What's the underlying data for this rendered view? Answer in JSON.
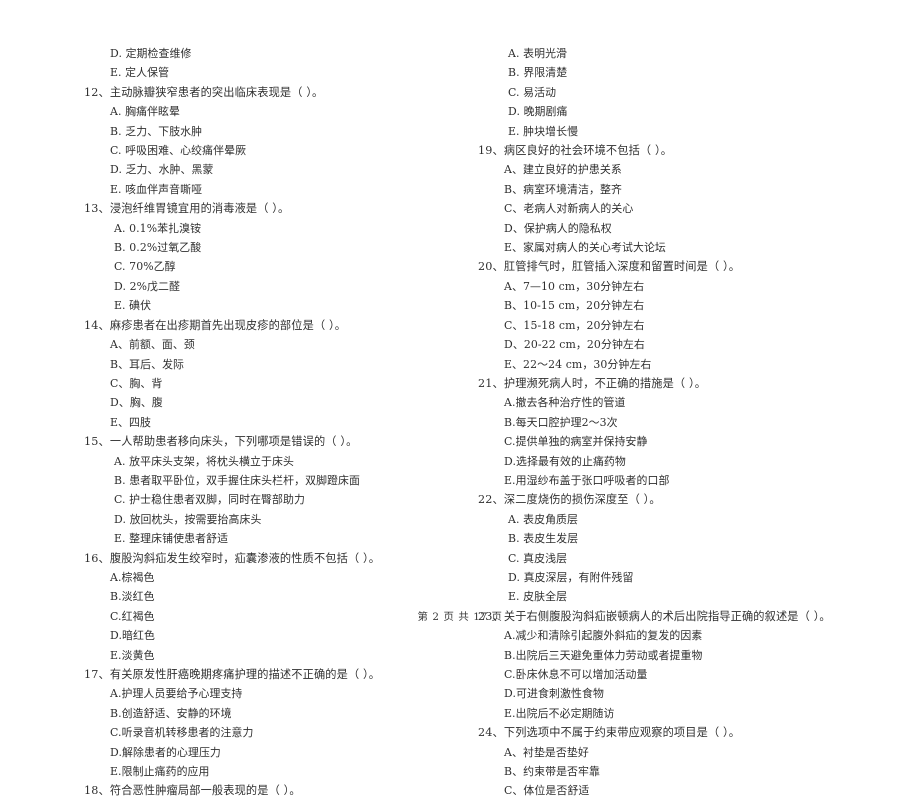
{
  "document": {
    "type": "exam-paper",
    "footer": "第 2 页 共 17 页",
    "page_number": "2",
    "total_pages": "17",
    "text_color": "#2f2f2f",
    "background_color": "#ffffff"
  },
  "left_column": {
    "orphan_options": [
      "D. 定期检查维修",
      "E. 定人保管"
    ],
    "questions": [
      {
        "number": "12",
        "stem": "12、主动脉瓣狭窄患者的突出临床表现是（      ）。",
        "options": [
          "A. 胸痛伴眩晕",
          "B. 乏力、下肢水肿",
          "C. 呼吸困难、心绞痛伴晕厥",
          "D. 乏力、水肿、黑蒙",
          "E. 咳血伴声音嘶哑"
        ]
      },
      {
        "number": "13",
        "stem": "13、浸泡纤维胃镜宜用的消毒液是（      ）。",
        "options": [
          "A. 0.1%苯扎溴铵",
          "B. 0.2%过氧乙酸",
          "C. 70%乙醇",
          "D. 2%戊二醛",
          "E. 碘伏"
        ]
      },
      {
        "number": "14",
        "stem": "14、麻疹患者在出疹期首先出现皮疹的部位是（      ）。",
        "options": [
          "A、前额、面、颈",
          "B、耳后、发际",
          "C、胸、背",
          "D、胸、腹",
          "E、四肢"
        ]
      },
      {
        "number": "15",
        "stem": "15、一人帮助患者移向床头，下列哪项是错误的（      ）。",
        "options": [
          "A.  放平床头支架，将枕头横立于床头",
          "B.  患者取平卧位，双手握住床头栏杆，双脚蹬床面",
          "C.  护士稳住患者双脚，同时在臀部助力",
          "D.  放回枕头，按需要抬高床头",
          "E.  整理床铺使患者舒适"
        ]
      },
      {
        "number": "16",
        "stem": "16、腹股沟斜疝发生绞窄时，疝囊渗液的性质不包括（      ）。",
        "options": [
          "A.棕褐色",
          "B.淡红色",
          "C.红褐色",
          "D.暗红色",
          "E.淡黄色"
        ]
      },
      {
        "number": "17",
        "stem": "17、有关原发性肝癌晚期疼痛护理的描述不正确的是（      ）。",
        "options": [
          "A.护理人员要给予心理支持",
          "B.创造舒适、安静的环境",
          "C.听录音机转移患者的注意力",
          "D.解除患者的心理压力",
          "E.限制止痛药的应用"
        ]
      },
      {
        "number": "18",
        "stem": "18、符合恶性肿瘤局部一般表现的是（      ）。",
        "options": []
      }
    ]
  },
  "right_column": {
    "orphan_options": [
      "A.  表明光滑",
      "B.  界限清楚",
      "C.  易活动",
      "D.  晚期剧痛",
      "E.  肿块增长慢"
    ],
    "questions": [
      {
        "number": "19",
        "stem": "19、病区良好的社会环境不包括（      ）。",
        "options": [
          "A、建立良好的护患关系",
          "B、病室环境清洁，整齐",
          "C、老病人对新病人的关心",
          "D、保护病人的隐私权",
          "E、家属对病人的关心考试大论坛"
        ]
      },
      {
        "number": "20",
        "stem": "20、肛管排气时，肛管插入深度和留置时间是（      ）。",
        "options": [
          "A、7—10 cm，30分钟左右",
          "B、10-15 cm，20分钟左右",
          "C、15-18 cm，20分钟左右",
          "D、20-22 cm，20分钟左右",
          "E、22～24 cm，30分钟左右"
        ]
      },
      {
        "number": "21",
        "stem": "21、护理濒死病人时，不正确的措施是（      ）。",
        "options": [
          "A.撤去各种治疗性的管道",
          "B.每天口腔护理2～3次",
          "C.提供单独的病室并保持安静",
          "D.选择最有效的止痛药物",
          "E.用湿纱布盖于张口呼吸者的口部"
        ]
      },
      {
        "number": "22",
        "stem": "22、深二度烧伤的损伤深度至（      ）。",
        "options": [
          "A.  表皮角质层",
          "B.  表皮生发层",
          "C.  真皮浅层",
          "D.  真皮深层，有附件残留",
          "E.  皮肤全层"
        ]
      },
      {
        "number": "23",
        "stem": "23、关于右侧腹股沟斜疝嵌顿病人的术后出院指导正确的叙述是（      ）。",
        "options": [
          "A.减少和清除引起腹外斜疝的复发的因素",
          "B.出院后三天避免重体力劳动或者提重物",
          "C.卧床休息不可以增加活动量",
          "D.可进食刺激性食物",
          "E.出院后不必定期随访"
        ]
      },
      {
        "number": "24",
        "stem": "24、下列选项中不属于约束带应观察的项目是（      ）。",
        "options": [
          "A、衬垫是否垫好",
          "B、约束带是否牢靠",
          "C、体位是否舒适"
        ]
      }
    ]
  }
}
